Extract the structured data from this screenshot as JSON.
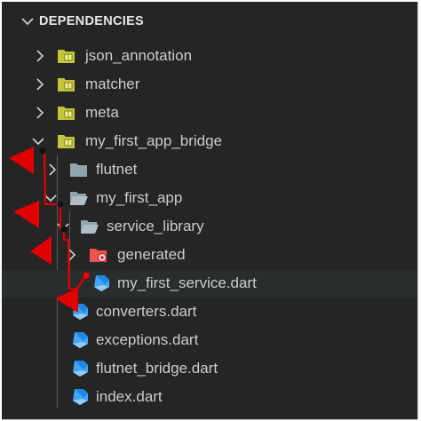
{
  "section_title": "DEPENDENCIES",
  "tree": [
    {
      "label": "json_annotation",
      "icon": "package-folder-icon",
      "expanded": false
    },
    {
      "label": "matcher",
      "icon": "package-folder-icon",
      "expanded": false
    },
    {
      "label": "meta",
      "icon": "package-folder-icon",
      "expanded": false
    },
    {
      "label": "my_first_app_bridge",
      "icon": "package-folder-icon",
      "expanded": true
    },
    {
      "label": "flutnet",
      "icon": "folder-icon",
      "expanded": false
    },
    {
      "label": "my_first_app",
      "icon": "folder-open-icon",
      "expanded": true
    },
    {
      "label": "service_library",
      "icon": "folder-open-icon",
      "expanded": true
    },
    {
      "label": "generated",
      "icon": "generated-folder-icon",
      "expanded": false
    },
    {
      "label": "my_first_service.dart",
      "icon": "dart-file-icon"
    },
    {
      "label": "converters.dart",
      "icon": "dart-file-icon"
    },
    {
      "label": "exceptions.dart",
      "icon": "dart-file-icon"
    },
    {
      "label": "flutnet_bridge.dart",
      "icon": "dart-file-icon"
    },
    {
      "label": "index.dart",
      "icon": "dart-file-icon"
    }
  ],
  "colors": {
    "background": "#252526",
    "text": "#cccccc",
    "package_folder": "#c5c53a",
    "folder": "#90a4ae",
    "generated_folder": "#ef5350",
    "dart": "#42a5f5",
    "annotation_red": "#e00000"
  }
}
